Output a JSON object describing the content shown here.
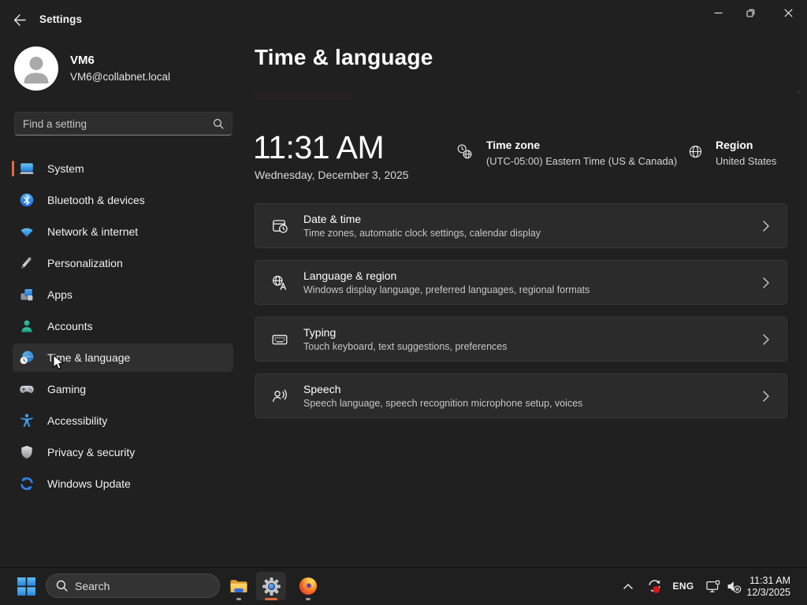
{
  "titlebar": {
    "app_title": "Settings"
  },
  "sidebar": {
    "user": {
      "name": "VM6",
      "email": "VM6@collabnet.local"
    },
    "search_placeholder": "Find a setting",
    "items": [
      {
        "label": "System"
      },
      {
        "label": "Bluetooth & devices"
      },
      {
        "label": "Network & internet"
      },
      {
        "label": "Personalization"
      },
      {
        "label": "Apps"
      },
      {
        "label": "Accounts"
      },
      {
        "label": "Time & language"
      },
      {
        "label": "Gaming"
      },
      {
        "label": "Accessibility"
      },
      {
        "label": "Privacy & security"
      },
      {
        "label": "Windows Update"
      }
    ],
    "selected_item": "Time & language"
  },
  "main": {
    "title": "Time & language",
    "clock": {
      "time": "11:31 AM",
      "date": "Wednesday, December 3, 2025"
    },
    "timezone": {
      "label": "Time zone",
      "value": "(UTC-05:00) Eastern Time (US & Canada)"
    },
    "region": {
      "label": "Region",
      "value": "United States"
    },
    "cards": [
      {
        "title": "Date & time",
        "desc": "Time zones, automatic clock settings, calendar display"
      },
      {
        "title": "Language & region",
        "desc": "Windows display language, preferred languages, regional formats"
      },
      {
        "title": "Typing",
        "desc": "Touch keyboard, text suggestions, preferences"
      },
      {
        "title": "Speech",
        "desc": "Speech language, speech recognition microphone setup, voices"
      }
    ]
  },
  "taskbar": {
    "search_placeholder": "Search",
    "tray": {
      "language": "ENG",
      "time": "11:31 AM",
      "date": "12/3/2025"
    }
  },
  "colors": {
    "background": "#202020",
    "card": "#2b2b2b",
    "accent": "#e06a45",
    "taskbar": "#1f1f1f"
  }
}
